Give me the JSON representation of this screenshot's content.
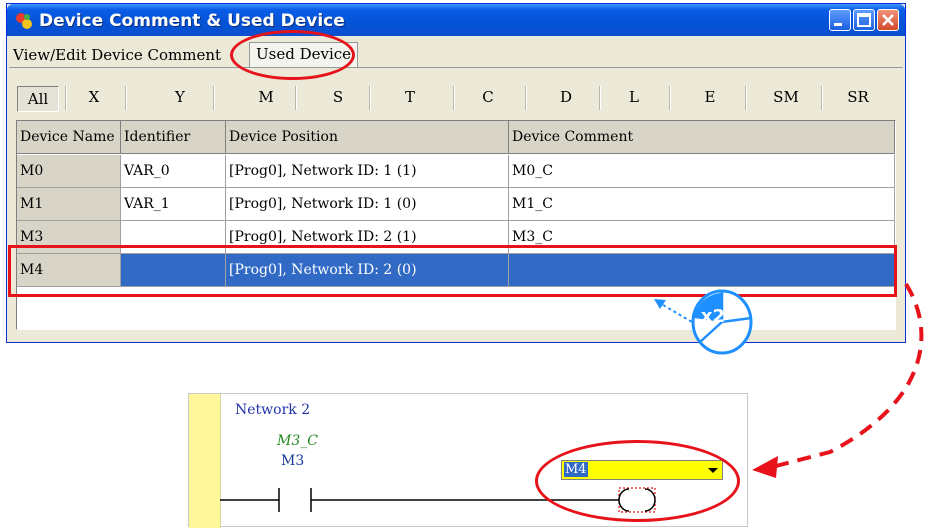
{
  "window": {
    "title": "Device Comment & Used Device"
  },
  "tabs": [
    {
      "label": "View/Edit Device Comment"
    },
    {
      "label": "Used Device"
    }
  ],
  "filters": [
    {
      "label": "All"
    },
    {
      "label": "X"
    },
    {
      "label": "Y"
    },
    {
      "label": "M"
    },
    {
      "label": "S"
    },
    {
      "label": "T"
    },
    {
      "label": "C"
    },
    {
      "label": "D"
    },
    {
      "label": "L"
    },
    {
      "label": "E"
    },
    {
      "label": "SM"
    },
    {
      "label": "SR"
    }
  ],
  "active_filter": "All",
  "table": {
    "columns": [
      "Device Name",
      "Identifier",
      "Device Position",
      "Device Comment"
    ],
    "rows": [
      {
        "name": "M0",
        "identifier": "VAR_0",
        "position": "[Prog0], Network ID: 1 (1)",
        "comment": "M0_C"
      },
      {
        "name": "M1",
        "identifier": "VAR_1",
        "position": "[Prog0], Network ID: 1 (0)",
        "comment": "M1_C"
      },
      {
        "name": "M3",
        "identifier": "",
        "position": "[Prog0], Network ID: 2 (1)",
        "comment": "M3_C"
      },
      {
        "name": "M4",
        "identifier": "",
        "position": "[Prog0], Network ID: 2 (0)",
        "comment": ""
      }
    ],
    "selected_row": "M4"
  },
  "callout": {
    "badge": "x2"
  },
  "ladder": {
    "network_label": "Network 2",
    "contact_comment": "M3_C",
    "contact_device": "M3",
    "coil_input_value": "M4"
  },
  "colors": {
    "annotation": "#e8121a",
    "selection": "#316ac5",
    "rail": "#fff799",
    "coil_input": "#ffff00",
    "callout": "#1e90ff"
  }
}
